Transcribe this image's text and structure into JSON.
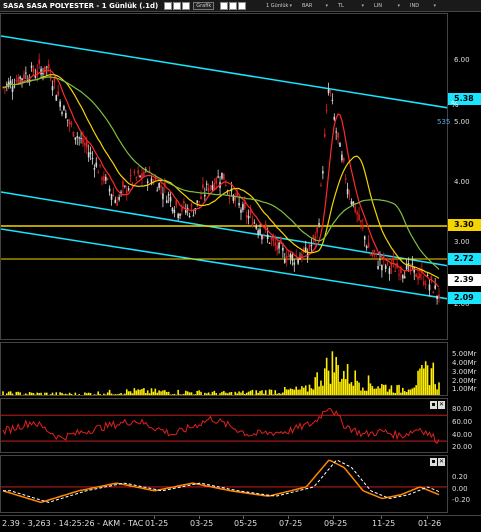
{
  "title": "SASA SASA POLYESTER - 1 Günlük (.1d)",
  "toolbar": {
    "mini_label": "Grafik",
    "menus": [
      "1 Günlük",
      "BAR",
      "TL",
      "LIN",
      "IND"
    ]
  },
  "price_axis": {
    "ticks": [
      "6.00",
      "5.00",
      "4.00",
      "3.00",
      "2.00"
    ],
    "labels": [
      {
        "text": "5.38",
        "color": "#19e5ff"
      },
      {
        "text": "3.30",
        "color": "#f5d400"
      },
      {
        "text": "2.72",
        "color": "#19e5ff"
      },
      {
        "text": "2.39",
        "color": "#ffffff"
      },
      {
        "text": "2.09",
        "color": "#19e5ff"
      }
    ],
    "percent_label": "535",
    "percent_sign": "%"
  },
  "volume_axis": {
    "ticks": [
      "5.00Mr",
      "4.00Mr",
      "3.00Mr",
      "2.00Mr",
      "1.00Mr"
    ]
  },
  "rsi_axis": {
    "ticks": [
      "80.00",
      "60.00",
      "40.00",
      "20.00"
    ]
  },
  "macd_axis": {
    "ticks": [
      "0.20",
      "0.00",
      "-0.20"
    ]
  },
  "status": {
    "text": "2.39 - 3,263 - 14:25:26 - AKM - TAC",
    "dates": [
      "01-25",
      "03-25",
      "05-25",
      "07-25",
      "09-25",
      "11-25",
      "01-26"
    ]
  },
  "chart_data": {
    "type": "candlestick",
    "symbol": "SASA",
    "last_price": 2.39,
    "levels": [
      {
        "price": 5.38,
        "color": "#19e5ff"
      },
      {
        "price": 3.3,
        "color": "#f5d400"
      },
      {
        "price": 2.72,
        "color": "#19e5ff"
      },
      {
        "price": 2.39,
        "color": "#ffffff"
      },
      {
        "price": 2.09,
        "color": "#19e5ff"
      }
    ],
    "close_path": [
      [
        0,
        5.5
      ],
      [
        6,
        5.7
      ],
      [
        12,
        5.8
      ],
      [
        15,
        5.3
      ],
      [
        18,
        4.9
      ],
      [
        22,
        4.6
      ],
      [
        26,
        4.2
      ],
      [
        30,
        3.8
      ],
      [
        34,
        4.1
      ],
      [
        38,
        4.2
      ],
      [
        42,
        4.0
      ],
      [
        46,
        3.7
      ],
      [
        50,
        3.65
      ],
      [
        54,
        4.0
      ],
      [
        58,
        4.2
      ],
      [
        60,
        3.9
      ],
      [
        64,
        3.6
      ],
      [
        68,
        3.4
      ],
      [
        72,
        3.1
      ],
      [
        76,
        2.95
      ],
      [
        80,
        3.0
      ],
      [
        83,
        3.3
      ],
      [
        86,
        5.55
      ],
      [
        88,
        4.8
      ],
      [
        91,
        4.0
      ],
      [
        94,
        3.5
      ],
      [
        97,
        3.0
      ],
      [
        100,
        2.85
      ],
      [
        104,
        2.8
      ],
      [
        108,
        2.75
      ],
      [
        112,
        2.6
      ],
      [
        115,
        2.39
      ]
    ],
    "volume_path": [
      [
        0,
        0.5
      ],
      [
        20,
        0.4
      ],
      [
        35,
        0.8
      ],
      [
        60,
        0.5
      ],
      [
        80,
        1.0
      ],
      [
        84,
        3.0
      ],
      [
        87,
        4.5
      ],
      [
        90,
        3.2
      ],
      [
        95,
        2.0
      ],
      [
        100,
        1.5
      ],
      [
        105,
        1.0
      ],
      [
        110,
        2.5
      ],
      [
        113,
        4.0
      ],
      [
        115,
        1.5
      ]
    ],
    "rsi_path": [
      [
        0,
        45
      ],
      [
        8,
        60
      ],
      [
        15,
        35
      ],
      [
        25,
        50
      ],
      [
        35,
        62
      ],
      [
        45,
        40
      ],
      [
        55,
        65
      ],
      [
        65,
        40
      ],
      [
        75,
        45
      ],
      [
        82,
        58
      ],
      [
        86,
        85
      ],
      [
        90,
        55
      ],
      [
        95,
        40
      ],
      [
        100,
        45
      ],
      [
        105,
        38
      ],
      [
        110,
        50
      ],
      [
        115,
        30
      ]
    ],
    "macd_path": [
      [
        0,
        -0.05
      ],
      [
        10,
        -0.2
      ],
      [
        20,
        -0.05
      ],
      [
        30,
        0.05
      ],
      [
        40,
        -0.05
      ],
      [
        50,
        0.05
      ],
      [
        60,
        -0.05
      ],
      [
        70,
        -0.12
      ],
      [
        80,
        0.0
      ],
      [
        86,
        0.35
      ],
      [
        90,
        0.25
      ],
      [
        95,
        -0.05
      ],
      [
        100,
        -0.15
      ],
      [
        105,
        -0.1
      ],
      [
        110,
        0.0
      ],
      [
        115,
        -0.1
      ]
    ],
    "x_range": [
      0,
      115
    ],
    "price_range": [
      1.7,
      6.6
    ],
    "volume_range": [
      0,
      5.5
    ],
    "rsi_range": [
      10,
      95
    ],
    "macd_range": [
      -0.35,
      0.4
    ],
    "colors": {
      "candle": "#e02020",
      "volume": "#ffee00",
      "rsi": "#e02020",
      "macd": "#ff8800",
      "signal": "#ffffff"
    }
  }
}
